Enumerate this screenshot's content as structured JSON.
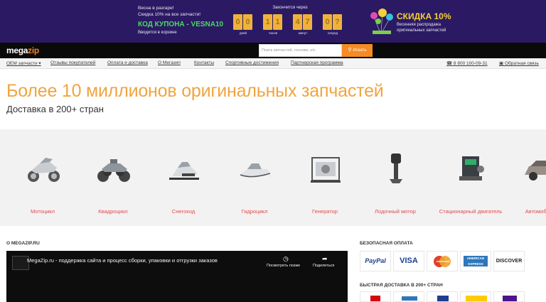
{
  "promo": {
    "line1": "Весна в разгаре!",
    "line2": "Скидка 10% на все запчасти!",
    "code_text": "КОД КУПОНА - VESNA10",
    "code_sub": "Вводится в корзине",
    "timer_title": "Закончится через",
    "timer": [
      {
        "digits": [
          "0",
          "0"
        ],
        "label": "дней"
      },
      {
        "digits": [
          "1",
          "1"
        ],
        "label": "часов"
      },
      {
        "digits": [
          "4",
          "7"
        ],
        "label": "минут"
      },
      {
        "digits": [
          "0",
          "?"
        ],
        "label": "секунд"
      }
    ],
    "sale_title": "СКИДКА 10%",
    "sale_sub": "Весенняя распродажа оригинальных запчастей"
  },
  "header": {
    "logo_prefix": "mega",
    "logo_suffix": "zip",
    "search_placeholder": "Поиск запчастей, техники, etc",
    "search_button": "Искать"
  },
  "nav": {
    "items": [
      "OEM запчасти",
      "Отзывы покупателей",
      "Оплата и доставка",
      "О Мегазип",
      "Контакты",
      "Спортивные достижения",
      "Партнерская программа"
    ],
    "phone": "8 800 100-09-31",
    "feedback": "Обратная связь"
  },
  "hero": {
    "title": "Более 10 миллионов оригинальных запчастей",
    "subtitle": "Доставка в 200+ стран"
  },
  "categories": [
    {
      "label": "Мотоцикл",
      "icon": "motorcycle-icon"
    },
    {
      "label": "Квадроцикл",
      "icon": "atv-icon"
    },
    {
      "label": "Снегоход",
      "icon": "snowmobile-icon"
    },
    {
      "label": "Гидроцикл",
      "icon": "jetski-icon"
    },
    {
      "label": "Генератор",
      "icon": "generator-icon"
    },
    {
      "label": "Лодочный мотор",
      "icon": "outboard-motor-icon"
    },
    {
      "label": "Стационарный двигатель",
      "icon": "engine-icon"
    },
    {
      "label": "Автомобиль",
      "icon": "car-icon"
    }
  ],
  "about": {
    "heading": "О MEGAZIP.RU",
    "video_title": "MegaZip.ru - поддержка сайта и процесс сборки, упаковки и отгрузки заказов",
    "watch_later": "Посмотреть позже",
    "share": "Поделиться"
  },
  "payment": {
    "heading": "БЕЗОПАСНАЯ ОПЛАТА",
    "cards": [
      {
        "name": "PayPal",
        "color": "#1d3f8f"
      },
      {
        "name": "VISA",
        "color": "#1a3d8f"
      },
      {
        "name": "mastercard",
        "color": "#e0412a"
      },
      {
        "name": "AMERICAN EXPRESS",
        "color": "#2e77bb"
      },
      {
        "name": "DISCOVER",
        "color": "#222222"
      }
    ]
  },
  "delivery": {
    "heading": "БЫСТРАЯ ДОСТАВКА В 200+ СТРАН"
  },
  "colors": {
    "promo_bg": "#2b1a63",
    "accent": "#f48b25",
    "hero_title": "#f1a43f",
    "category_label": "#e24b4b"
  }
}
